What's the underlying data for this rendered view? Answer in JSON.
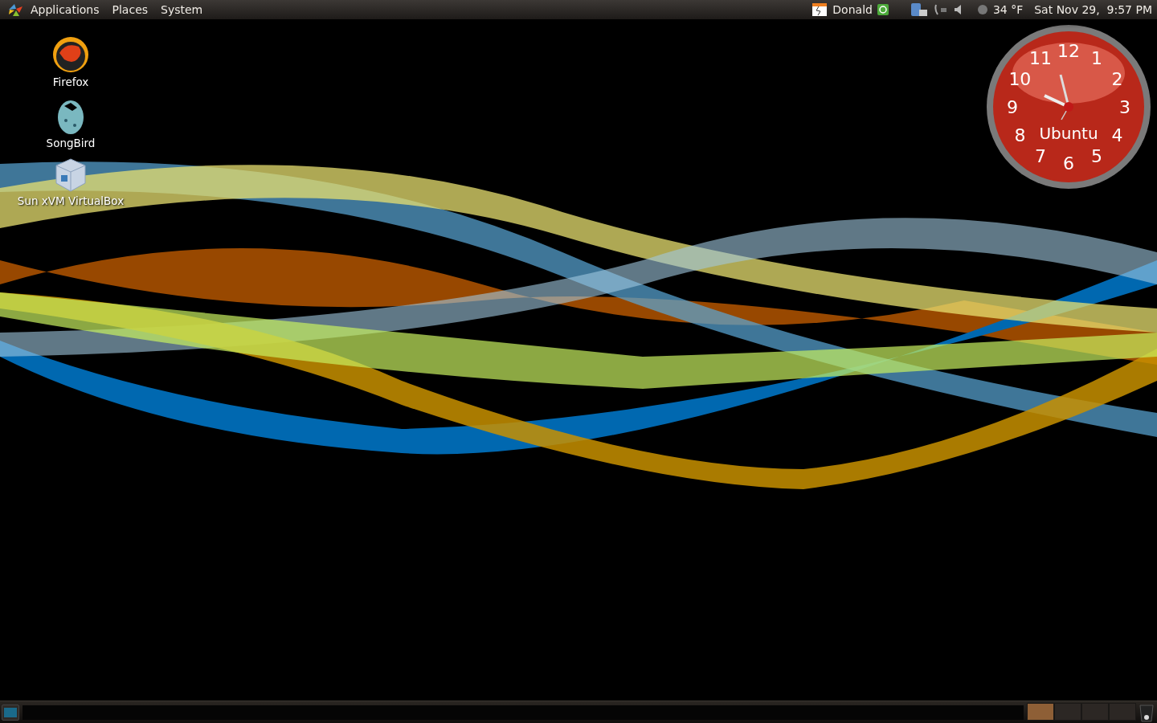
{
  "top_panel": {
    "menus": [
      {
        "label": "Applications"
      },
      {
        "label": "Places"
      },
      {
        "label": "System"
      }
    ],
    "user": "Donald",
    "weather": "34 °F",
    "clock": "Sat Nov 29,  9:57 PM"
  },
  "desktop_icons": [
    {
      "label": "Firefox",
      "kind": "firefox"
    },
    {
      "label": "SongBird",
      "kind": "songbird"
    },
    {
      "label": "Sun xVM VirtualBox",
      "kind": "virtualbox"
    }
  ],
  "clock_widget": {
    "numerals": [
      "12",
      "11",
      "1",
      "10",
      "2",
      "9",
      "3",
      "8",
      "4",
      "7",
      "5",
      "6"
    ],
    "brand": "Ubuntu"
  },
  "bottom_panel": {
    "workspaces": [
      {
        "selected": true
      },
      {
        "selected": false
      },
      {
        "selected": false
      },
      {
        "selected": false
      }
    ]
  }
}
